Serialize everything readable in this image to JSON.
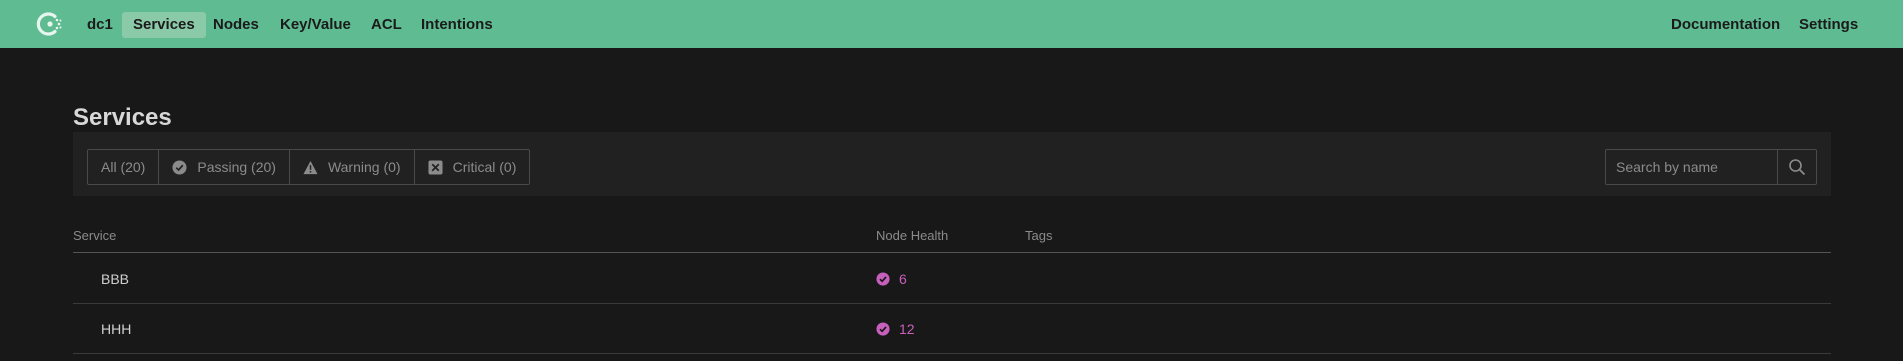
{
  "nav": {
    "datacenter": "dc1",
    "items": [
      {
        "label": "Services",
        "active": true
      },
      {
        "label": "Nodes",
        "active": false
      },
      {
        "label": "Key/Value",
        "active": false
      },
      {
        "label": "ACL",
        "active": false
      },
      {
        "label": "Intentions",
        "active": false
      }
    ],
    "right": [
      "Documentation",
      "Settings"
    ],
    "brand_color": "#5ebb92"
  },
  "page": {
    "title": "Services"
  },
  "filters": [
    {
      "label": "All (20)",
      "icon": null
    },
    {
      "label": "Passing (20)",
      "icon": "check-circle-icon"
    },
    {
      "label": "Warning (0)",
      "icon": "warning-triangle-icon"
    },
    {
      "label": "Critical (0)",
      "icon": "critical-x-icon"
    }
  ],
  "search": {
    "placeholder": "Search by name",
    "value": ""
  },
  "table": {
    "columns": [
      "Service",
      "Node Health",
      "Tags"
    ],
    "rows": [
      {
        "service": "BBB",
        "passing": "6",
        "tags": ""
      },
      {
        "service": "HHH",
        "passing": "12",
        "tags": ""
      }
    ]
  },
  "colors": {
    "passing": "#c75fbc"
  }
}
